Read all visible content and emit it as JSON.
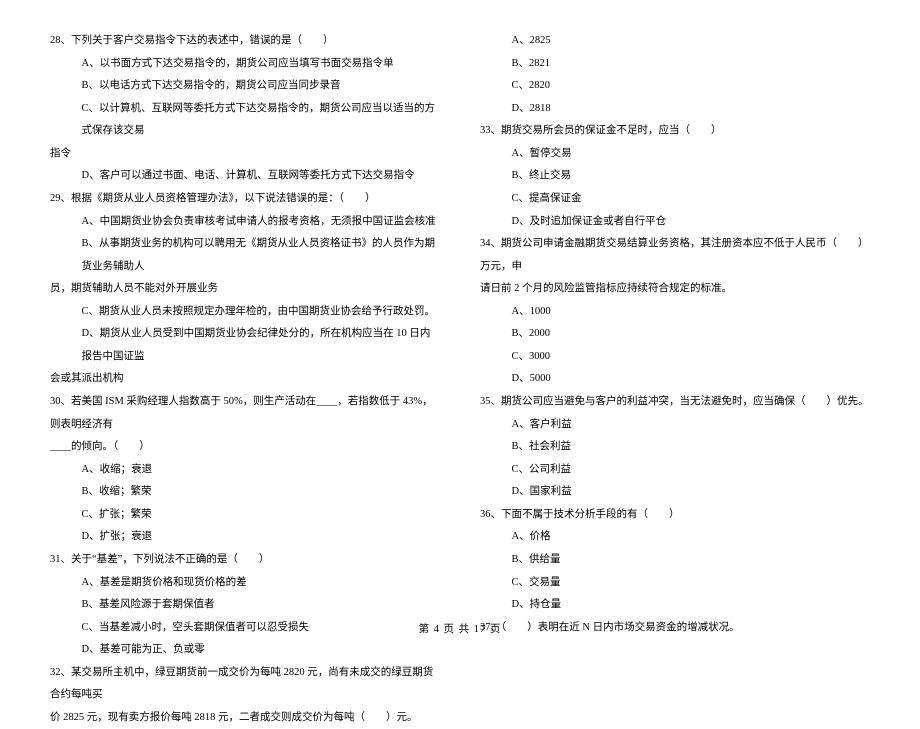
{
  "footer": "第 4 页 共 17 页",
  "left": {
    "q28": {
      "stem": "28、下列关于客户交易指令下达的表述中，错误的是（　　）",
      "a": "A、以书面方式下达交易指令的，期货公司应当填写书面交易指令单",
      "b": "B、以电话方式下达交易指令的，期货公司应当同步录音",
      "c": "C、以计算机、互联网等委托方式下达交易指令的，期货公司应当以适当的方式保存该交易",
      "c2": "指令",
      "d": "D、客户可以通过书面、电话、计算机、互联网等委托方式下达交易指令"
    },
    "q29": {
      "stem": "29、根据《期货从业人员资格管理办法》，以下说法错误的是：（　　）",
      "a": "A、中国期货业协会负责审核考试申请人的报考资格，无须报中国证监会核准",
      "b": "B、从事期货业务的机构可以聘用无《期货从业人员资格证书》的人员作为期货业务辅助人",
      "b2": "员，期货辅助人员不能对外开展业务",
      "c": "C、期货从业人员未按照规定办理年检的，由中国期货业协会给予行政处罚。",
      "d": "D、期货从业人员受到中国期货业协会纪律处分的，所在机构应当在 10 日内报告中国证监",
      "d2": "会或其派出机构"
    },
    "q30": {
      "stem": "30、若美国 ISM 采购经理人指数高于 50%，则生产活动在____，若指数低于 43%，则表明经济有",
      "stem2": "____的倾向。（　　）",
      "a": "A、收缩；衰退",
      "b": "B、收缩；繁荣",
      "c": "C、扩张；繁荣",
      "d": "D、扩张；衰退"
    },
    "q31": {
      "stem": "31、关于“基差”，下列说法不正确的是（　　）",
      "a": "A、基差是期货价格和现货价格的差",
      "b": "B、基差风险源于套期保值者",
      "c": "C、当基差减小时，空头套期保值者可以忍受损失",
      "d": "D、基差可能为正、负或零"
    },
    "q32": {
      "stem": "32、某交易所主机中，绿豆期货前一成交价为每吨 2820 元，尚有未成交的绿豆期货合约每吨买",
      "stem2": "价 2825 元，现有卖方报价每吨 2818 元，二者成交则成交价为每吨（　　）元。"
    }
  },
  "right": {
    "q32opts": {
      "a": "A、2825",
      "b": "B、2821",
      "c": "C、2820",
      "d": "D、2818"
    },
    "q33": {
      "stem": "33、期货交易所会员的保证金不足时，应当（　　）",
      "a": "A、暂停交易",
      "b": "B、终止交易",
      "c": "C、提高保证金",
      "d": "D、及时追加保证金或者自行平仓"
    },
    "q34": {
      "stem": "34、期货公司申请金融期货交易结算业务资格，其注册资本应不低于人民币（　　）万元，申",
      "stem2": "请日前 2 个月的风险监管指标应持续符合规定的标准。",
      "a": "A、1000",
      "b": "B、2000",
      "c": "C、3000",
      "d": "D、5000"
    },
    "q35": {
      "stem": "35、期货公司应当避免与客户的利益冲突，当无法避免时，应当确保（　　）优先。",
      "a": "A、客户利益",
      "b": "B、社会利益",
      "c": "C、公司利益",
      "d": "D、国家利益"
    },
    "q36": {
      "stem": "36、下面不属于技术分析手段的有（　　）",
      "a": "A、价格",
      "b": "B、供给量",
      "c": "C、交易量",
      "d": "D、持仓量"
    },
    "q37": {
      "stem": "37、（　　）表明在近 N 日内市场交易资金的增减状况。"
    }
  }
}
